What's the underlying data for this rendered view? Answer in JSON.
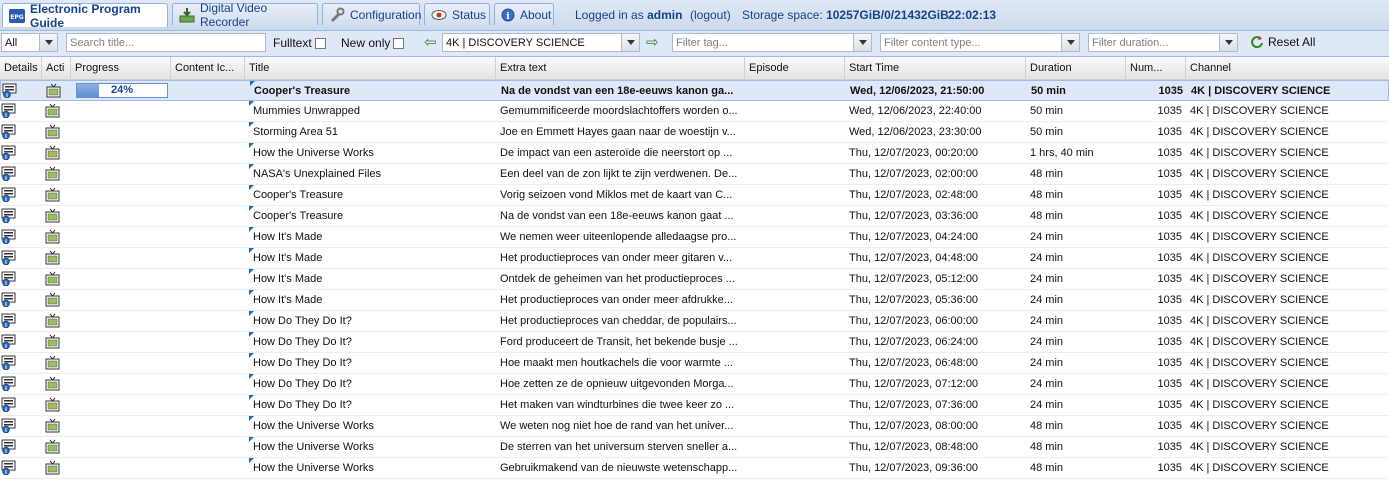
{
  "tabs": [
    {
      "label": "Electronic Program Guide",
      "icon": "epg-icon",
      "active": true
    },
    {
      "label": "Digital Video Recorder",
      "icon": "dvr-download-icon",
      "active": false
    },
    {
      "label": "Configuration",
      "icon": "wrench-icon",
      "active": false
    },
    {
      "label": "Status",
      "icon": "eye-icon",
      "active": false
    },
    {
      "label": "About",
      "icon": "info-icon",
      "active": false
    }
  ],
  "top_info": {
    "logged_in_prefix": "Logged in as",
    "user": "admin",
    "logout": "(logout)",
    "storage_prefix": "Storage space:",
    "storage_value": "10257GiB/0/21432GiB",
    "clock": "22:02:13"
  },
  "toolbar": {
    "mode_value": "All",
    "search_placeholder": "Search title...",
    "fulltext_label": "Fulltext",
    "new_only_label": "New only",
    "channel_value": "4K | DISCOVERY SCIENCE",
    "tag_placeholder": "Filter tag...",
    "content_type_placeholder": "Filter content type...",
    "duration_placeholder": "Filter duration...",
    "reset_label": "Reset All"
  },
  "columns": [
    "Details",
    "Acti",
    "Progress",
    "Content Ic...",
    "Title",
    "Extra text",
    "Episode",
    "Start Time",
    "Duration",
    "Num...",
    "Channel"
  ],
  "rows": [
    {
      "title": "Cooper's Treasure",
      "extra": "Na de vondst van een 18e-eeuws kanon ga...",
      "start": "Wed, 12/06/2023, 21:50:00",
      "duration": "50 min",
      "num": "1035",
      "channel": "4K | DISCOVERY SCIENCE",
      "progress": 24,
      "progress_label": "24%"
    },
    {
      "title": "Mummies Unwrapped",
      "extra": "Gemummificeerde moordslachtoffers worden o...",
      "start": "Wed, 12/06/2023, 22:40:00",
      "duration": "50 min",
      "num": "1035",
      "channel": "4K | DISCOVERY SCIENCE"
    },
    {
      "title": "Storming Area 51",
      "extra": "Joe en Emmett Hayes gaan naar de woestijn v...",
      "start": "Wed, 12/06/2023, 23:30:00",
      "duration": "50 min",
      "num": "1035",
      "channel": "4K | DISCOVERY SCIENCE"
    },
    {
      "title": "How the Universe Works",
      "extra": "De impact van een asteroïde die neerstort op ...",
      "start": "Thu, 12/07/2023, 00:20:00",
      "duration": "1 hrs, 40 min",
      "num": "1035",
      "channel": "4K | DISCOVERY SCIENCE"
    },
    {
      "title": "NASA's Unexplained Files",
      "extra": "Een deel van de zon lijkt te zijn verdwenen. De...",
      "start": "Thu, 12/07/2023, 02:00:00",
      "duration": "48 min",
      "num": "1035",
      "channel": "4K | DISCOVERY SCIENCE"
    },
    {
      "title": "Cooper's Treasure",
      "extra": "Vorig seizoen vond Miklos met de kaart van C...",
      "start": "Thu, 12/07/2023, 02:48:00",
      "duration": "48 min",
      "num": "1035",
      "channel": "4K | DISCOVERY SCIENCE"
    },
    {
      "title": "Cooper's Treasure",
      "extra": "Na de vondst van een 18e-eeuws kanon gaat ...",
      "start": "Thu, 12/07/2023, 03:36:00",
      "duration": "48 min",
      "num": "1035",
      "channel": "4K | DISCOVERY SCIENCE"
    },
    {
      "title": "How It's Made",
      "extra": "We nemen weer uiteenlopende alledaagse pro...",
      "start": "Thu, 12/07/2023, 04:24:00",
      "duration": "24 min",
      "num": "1035",
      "channel": "4K | DISCOVERY SCIENCE"
    },
    {
      "title": "How It's Made",
      "extra": "Het productieproces van onder meer gitaren v...",
      "start": "Thu, 12/07/2023, 04:48:00",
      "duration": "24 min",
      "num": "1035",
      "channel": "4K | DISCOVERY SCIENCE"
    },
    {
      "title": "How It's Made",
      "extra": "Ontdek de geheimen van het productieproces ...",
      "start": "Thu, 12/07/2023, 05:12:00",
      "duration": "24 min",
      "num": "1035",
      "channel": "4K | DISCOVERY SCIENCE"
    },
    {
      "title": "How It's Made",
      "extra": "Het productieproces van onder meer afdrukke...",
      "start": "Thu, 12/07/2023, 05:36:00",
      "duration": "24 min",
      "num": "1035",
      "channel": "4K | DISCOVERY SCIENCE"
    },
    {
      "title": "How Do They Do It?",
      "extra": "Het productieproces van cheddar, de populairs...",
      "start": "Thu, 12/07/2023, 06:00:00",
      "duration": "24 min",
      "num": "1035",
      "channel": "4K | DISCOVERY SCIENCE"
    },
    {
      "title": "How Do They Do It?",
      "extra": "Ford produceert de Transit, het bekende busje ...",
      "start": "Thu, 12/07/2023, 06:24:00",
      "duration": "24 min",
      "num": "1035",
      "channel": "4K | DISCOVERY SCIENCE"
    },
    {
      "title": "How Do They Do It?",
      "extra": "Hoe maakt men houtkachels die voor warmte ...",
      "start": "Thu, 12/07/2023, 06:48:00",
      "duration": "24 min",
      "num": "1035",
      "channel": "4K | DISCOVERY SCIENCE"
    },
    {
      "title": "How Do They Do It?",
      "extra": "Hoe zetten ze de opnieuw uitgevonden Morga...",
      "start": "Thu, 12/07/2023, 07:12:00",
      "duration": "24 min",
      "num": "1035",
      "channel": "4K | DISCOVERY SCIENCE"
    },
    {
      "title": "How Do They Do It?",
      "extra": "Het maken van windturbines die twee keer zo ...",
      "start": "Thu, 12/07/2023, 07:36:00",
      "duration": "24 min",
      "num": "1035",
      "channel": "4K | DISCOVERY SCIENCE"
    },
    {
      "title": "How the Universe Works",
      "extra": "We weten nog niet hoe de rand van het univer...",
      "start": "Thu, 12/07/2023, 08:00:00",
      "duration": "48 min",
      "num": "1035",
      "channel": "4K | DISCOVERY SCIENCE"
    },
    {
      "title": "How the Universe Works",
      "extra": "De sterren van het universum sterven sneller a...",
      "start": "Thu, 12/07/2023, 08:48:00",
      "duration": "48 min",
      "num": "1035",
      "channel": "4K | DISCOVERY SCIENCE"
    },
    {
      "title": "How the Universe Works",
      "extra": "Gebruikmakend van de nieuwste wetenschapp...",
      "start": "Thu, 12/07/2023, 09:36:00",
      "duration": "48 min",
      "num": "1035",
      "channel": "4K | DISCOVERY SCIENCE"
    }
  ],
  "colors": {
    "accent": "#15428b",
    "selected_row": "#dfe8f6",
    "progress_fill": "#5e8ed4",
    "toolbar_bg": "#dfe8f6"
  }
}
